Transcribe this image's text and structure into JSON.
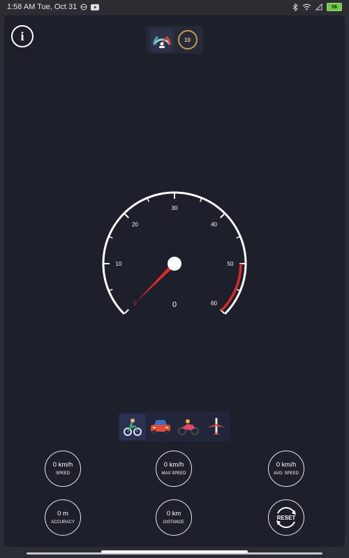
{
  "status": {
    "time_date": "1:58 AM Tue, Oct 31",
    "battery_level": "56"
  },
  "header": {
    "info_symbol": "i",
    "digital_mode_value": "10"
  },
  "speedometer": {
    "current_speed": "0",
    "min": 0,
    "max": 60,
    "needle_value": 0,
    "tick_labels": [
      "0",
      "10",
      "20",
      "30",
      "40",
      "50",
      "60"
    ],
    "accent_color": "#d92b2b"
  },
  "vehicles": [
    "bicycle-icon",
    "car-icon",
    "motorcycle-icon",
    "airplane-icon"
  ],
  "stats": {
    "speed": {
      "value": "0 km/h",
      "label": "SPEED"
    },
    "max_speed": {
      "value": "0 km/h",
      "label": "MAX SPEED"
    },
    "avg_speed": {
      "value": "0 km/h",
      "label": "AVG. SPEED"
    },
    "accuracy": {
      "value": "0 m",
      "label": "ACCURACY"
    },
    "distance": {
      "value": "0 km",
      "label": "DISTANCE"
    },
    "reset_label": "RESET"
  }
}
